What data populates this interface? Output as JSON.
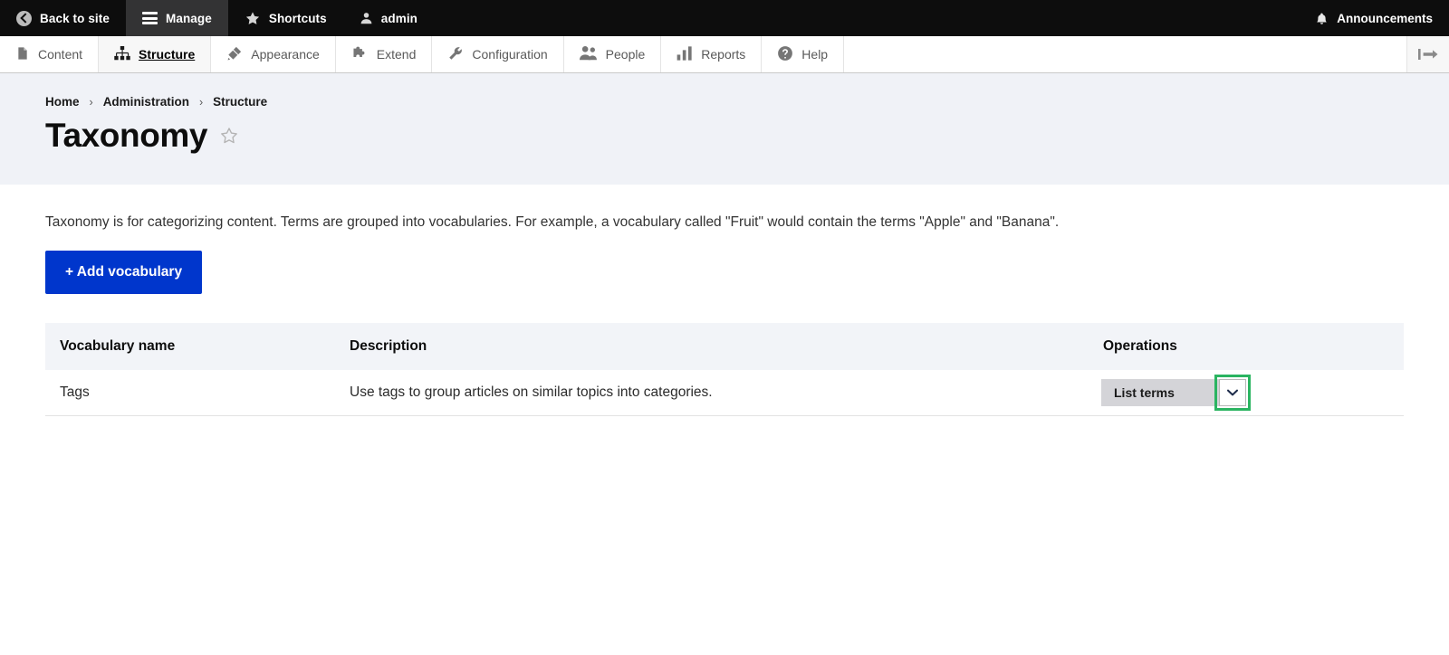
{
  "toolbar": {
    "back_to_site": "Back to site",
    "manage": "Manage",
    "shortcuts": "Shortcuts",
    "account": "admin",
    "announcements": "Announcements",
    "icons": {
      "back": "back-circle-arrow-icon",
      "manage": "hamburger-menu-icon",
      "shortcuts": "star-icon",
      "account": "person-icon",
      "announcements": "bell-icon"
    },
    "active_item": "Manage",
    "background": "#0d0d0d",
    "active_background": "#333334"
  },
  "subnav": {
    "items": [
      {
        "label": "Content",
        "icon": "document-icon",
        "active": false
      },
      {
        "label": "Structure",
        "icon": "sitemap-icon",
        "active": true
      },
      {
        "label": "Appearance",
        "icon": "paintbrush-icon",
        "active": false
      },
      {
        "label": "Extend",
        "icon": "puzzle-icon",
        "active": false
      },
      {
        "label": "Configuration",
        "icon": "wrench-icon",
        "active": false
      },
      {
        "label": "People",
        "icon": "people-icon",
        "active": false
      },
      {
        "label": "Reports",
        "icon": "bar-chart-icon",
        "active": false
      },
      {
        "label": "Help",
        "icon": "question-mark-icon",
        "active": false
      }
    ],
    "collapse_icon": "collapse-sidebar-icon"
  },
  "page_header": {
    "breadcrumb": [
      {
        "label": "Home"
      },
      {
        "label": "Administration"
      },
      {
        "label": "Structure"
      }
    ],
    "separator": "›",
    "title": "Taxonomy",
    "bookmark_icon": "star-outline-icon",
    "background": "#f0f2f7"
  },
  "main": {
    "intro": "Taxonomy is for categorizing content. Terms are grouped into vocabularies. For example, a vocabulary called \"Fruit\" would contain the terms \"Apple\" and \"Banana\".",
    "add_button": "+ Add vocabulary",
    "add_button_color": "#0036cc",
    "table": {
      "columns": [
        "Vocabulary name",
        "Description",
        "Operations"
      ],
      "rows": [
        {
          "name": "Tags",
          "description": "Use tags to group articles on similar topics into categories.",
          "operation_label": "List terms",
          "operation_toggle_icon": "chevron-down-icon"
        }
      ]
    }
  },
  "annotation": {
    "highlight_target": "operations-dropdown-toggle",
    "color": "#2bb461"
  }
}
